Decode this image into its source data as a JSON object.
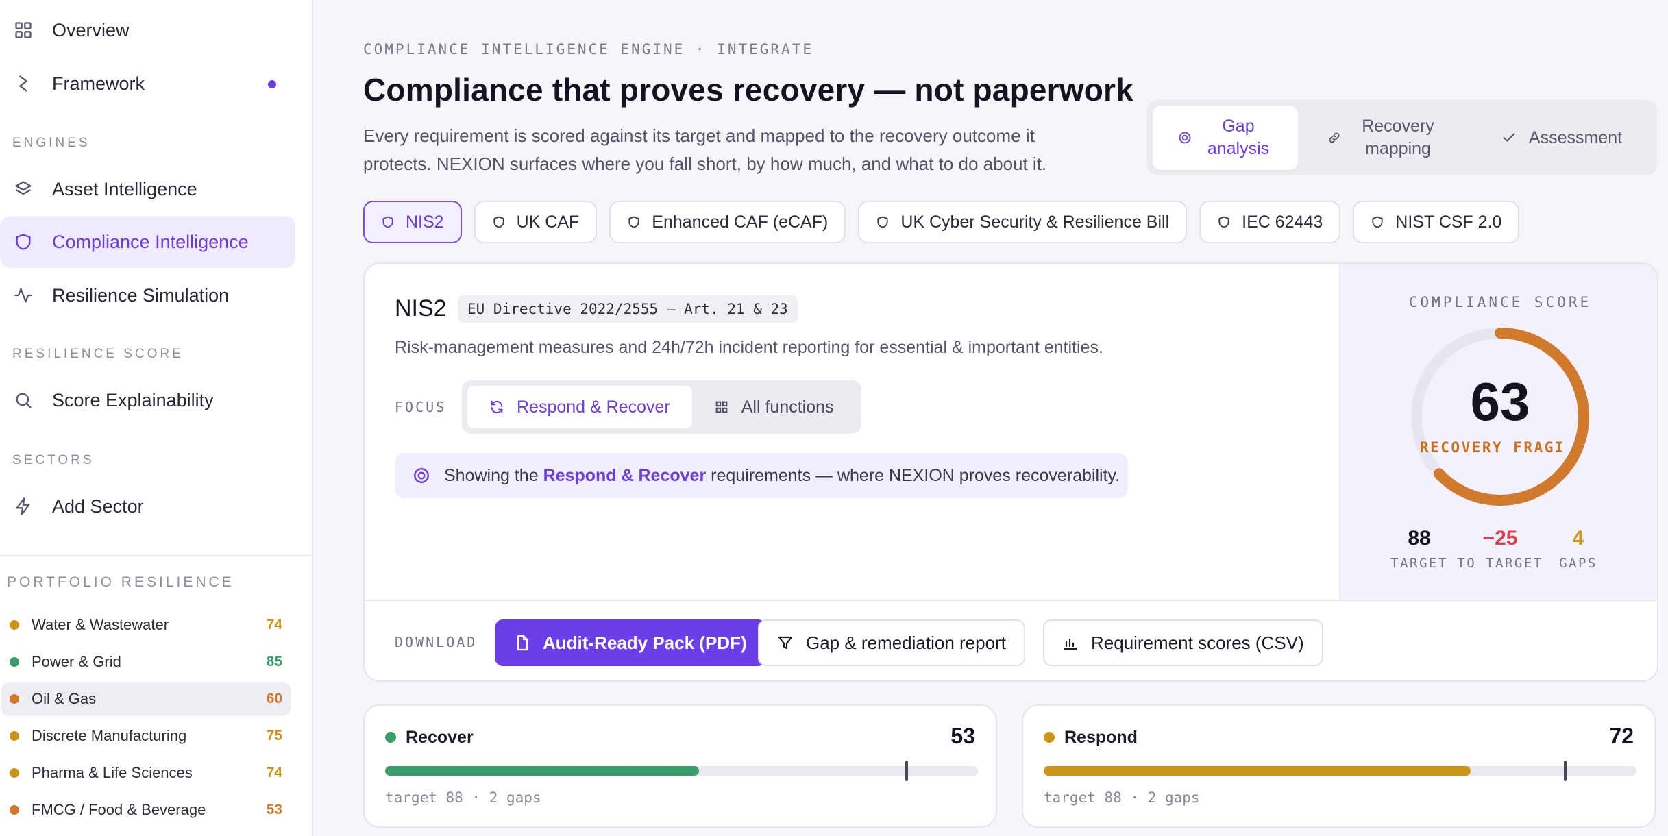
{
  "sidebar": {
    "nav": [
      {
        "label": "Overview",
        "icon": "grid-icon"
      },
      {
        "label": "Framework",
        "icon": "framework-icon"
      }
    ],
    "sections": {
      "engines": "ENGINES",
      "resilience_score": "RESILIENCE SCORE",
      "sectors": "SECTORS"
    },
    "engines": [
      {
        "label": "Asset Intelligence",
        "icon": "layers-icon"
      },
      {
        "label": "Compliance Intelligence",
        "icon": "shield-icon",
        "active": true
      },
      {
        "label": "Resilience Simulation",
        "icon": "activity-icon"
      }
    ],
    "score_items": [
      {
        "label": "Score Explainability",
        "icon": "search-icon"
      }
    ],
    "sector_items": [
      {
        "label": "Add Sector",
        "icon": "bolt-icon"
      }
    ],
    "portfolio": {
      "title": "PORTFOLIO RESILIENCE",
      "rows": [
        {
          "name": "Water & Wastewater",
          "value": "74",
          "color": "#c9961a"
        },
        {
          "name": "Power & Grid",
          "value": "85",
          "color": "#3a9d6a"
        },
        {
          "name": "Oil & Gas",
          "value": "60",
          "color": "#d07a2e"
        },
        {
          "name": "Discrete Manufacturing",
          "value": "75",
          "color": "#c9961a"
        },
        {
          "name": "Pharma & Life Sciences",
          "value": "74",
          "color": "#c9961a"
        },
        {
          "name": "FMCG / Food & Beverage",
          "value": "53",
          "color": "#d07a2e"
        }
      ]
    }
  },
  "header": {
    "eyebrow": "COMPLIANCE INTELLIGENCE ENGINE · INTEGRATE",
    "title": "Compliance that proves recovery — not paperwork",
    "description": "Every requirement is scored against its target and mapped to the recovery outcome it protects. NEXION surfaces where you fall short, by how much, and what to do about it."
  },
  "view_toggle": {
    "gap_analysis": "Gap analysis",
    "recovery_mapping": "Recovery mapping",
    "assessment": "Assessment"
  },
  "frameworks": [
    "NIS2",
    "UK CAF",
    "Enhanced CAF (eCAF)",
    "UK Cyber Security & Resilience Bill",
    "IEC 62443",
    "NIST CSF 2.0"
  ],
  "detail": {
    "name": "NIS2",
    "reference": "EU Directive 2022/2555 — Art. 21 & 23",
    "description": "Risk-management measures and 24h/72h incident reporting for essential & important entities.",
    "focus_label": "FOCUS",
    "focus_options": {
      "respond_recover": "Respond & Recover",
      "all_functions": "All functions"
    },
    "note": {
      "before": "Showing the",
      "highlight": "Respond & Recover",
      "after": "requirements — where NEXION proves recoverability."
    }
  },
  "score": {
    "title": "COMPLIANCE SCORE",
    "value": "63",
    "fraction": 0.63,
    "status": "RECOVERY FRAGILE",
    "color": "#d07a2e",
    "stats": [
      {
        "value": "88",
        "label": "TARGET",
        "color": "#141322"
      },
      {
        "value": "−25",
        "label": "TO TARGET",
        "color": "#d6434f"
      },
      {
        "value": "4",
        "label": "GAPS",
        "color": "#c9961a"
      }
    ]
  },
  "download": {
    "label": "DOWNLOAD",
    "audit_pack": "Audit-Ready Pack (PDF)",
    "gap_report": "Gap & remediation report",
    "scores_csv": "Requirement scores (CSV)"
  },
  "functions": [
    {
      "name": "Recover",
      "score": "53",
      "fraction": 0.53,
      "target_fraction": 0.88,
      "meta": "target 88 · 2 gaps",
      "color": "#3a9d6a"
    },
    {
      "name": "Respond",
      "score": "72",
      "fraction": 0.72,
      "target_fraction": 0.88,
      "meta": "target 88 · 2 gaps",
      "color": "#c9961a"
    }
  ]
}
